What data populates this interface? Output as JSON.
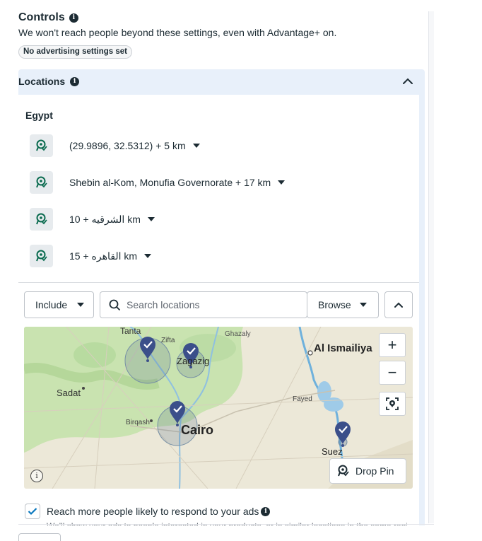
{
  "controls": {
    "title": "Controls",
    "subtitle": "We won't reach people beyond these settings, even with Advantage+ on.",
    "badge": "No advertising settings set"
  },
  "locations": {
    "header": "Locations",
    "country": "Egypt",
    "items": [
      {
        "label": "(29.9896, 32.5312) + 5 km"
      },
      {
        "label": "Shebin al-Kom, Monufia Governorate + 17 km"
      },
      {
        "label": "الشرقيه + 10 km"
      },
      {
        "label": "القاهره + 15 km"
      }
    ]
  },
  "search": {
    "include_label": "Include",
    "placeholder": "Search locations",
    "browse_label": "Browse"
  },
  "map": {
    "labels": {
      "tanta": "Tanta",
      "zifta": "Zifta",
      "ghazaly": "Ghazaly",
      "ismailiya": "Al Ismailiya",
      "zagazig": "Zagazig",
      "sadat": "Sadat",
      "fayed": "Fayed",
      "birqash": "Birqash",
      "cairo": "Cairo",
      "suez": "Suez"
    },
    "zoom_in": "+",
    "zoom_out": "−",
    "drop_pin_label": "Drop Pin",
    "info_glyph": "i",
    "colors": {
      "land": "#ece8d8",
      "green": "#c9e3b0",
      "water": "#9fcbe8",
      "pin": "#3b4f8a"
    }
  },
  "reach": {
    "checked": true,
    "label": "Reach more people likely to respond to your ads",
    "description": "We'll show your ads to people interested in your products, or in similar locations in the same region."
  }
}
